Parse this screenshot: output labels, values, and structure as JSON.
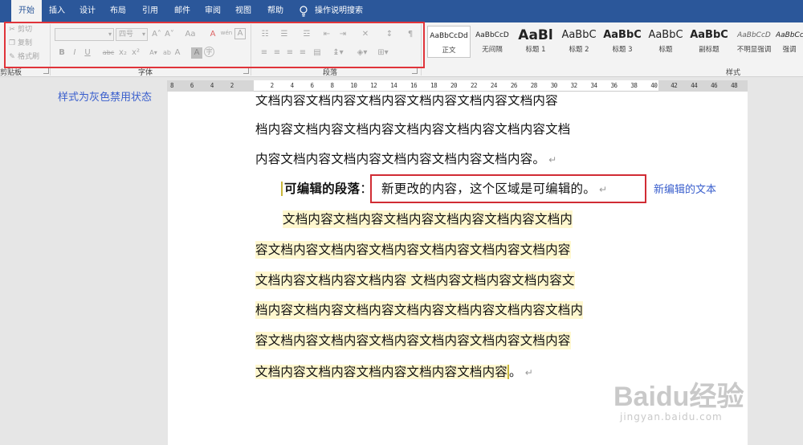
{
  "tabs": [
    {
      "label": "开始",
      "active": true
    },
    {
      "label": "插入"
    },
    {
      "label": "设计"
    },
    {
      "label": "布局"
    },
    {
      "label": "引用"
    },
    {
      "label": "邮件"
    },
    {
      "label": "审阅"
    },
    {
      "label": "视图"
    },
    {
      "label": "帮助"
    }
  ],
  "tell_me": "操作说明搜索",
  "ribbon": {
    "clipboard": {
      "cut": "剪切",
      "copy": "复制",
      "format_painter": "格式刷",
      "label": "剪贴板"
    },
    "font": {
      "font_name": "",
      "font_size": "四号",
      "bold": "B",
      "italic": "I",
      "underline": "U",
      "strikethrough": "abc",
      "subscript": "x₂",
      "superscript": "x²",
      "label": "字体",
      "grow": "A˄",
      "shrink": "A˅",
      "case": "Aa",
      "clear": "A",
      "phonetic": "wén",
      "border_char": "A",
      "highlight": "ab",
      "font_color": "A",
      "shading": "A",
      "enclose": "字"
    },
    "paragraph": {
      "label": "段落"
    },
    "styles": {
      "label": "样式",
      "items": [
        {
          "sample": "AaBbCcDd",
          "name": "正文",
          "selected": true
        },
        {
          "sample": "AaBbCcD",
          "name": "无间隔"
        },
        {
          "sample": "AaBl",
          "name": "标题 1"
        },
        {
          "sample": "AaBbC",
          "name": "标题 2"
        },
        {
          "sample": "AaBbC",
          "name": "标题 3"
        },
        {
          "sample": "AaBbC",
          "name": "标题"
        },
        {
          "sample": "AaBbC",
          "name": "副标题"
        },
        {
          "sample": "AaBbCcD",
          "name": "不明显强调"
        },
        {
          "sample": "AaBbCc",
          "name": "强调"
        }
      ]
    }
  },
  "ruler": {
    "ticks": [
      "8",
      "6",
      "4",
      "2",
      "",
      "2",
      "4",
      "6",
      "8",
      "10",
      "12",
      "14",
      "16",
      "18",
      "20",
      "22",
      "24",
      "26",
      "28",
      "30",
      "32",
      "34",
      "36",
      "38",
      "40",
      "42",
      "44",
      "46",
      "48"
    ]
  },
  "annotations": {
    "disabled_note": "样式为灰色禁用状态",
    "edited_note": "新编辑的文本"
  },
  "document": {
    "top_lines": [
      "文档内容文档内容文档内容文档内容文档内容文档内容",
      "档内容文档内容文档内容文档内容文档内容文档内容文档",
      "内容文档内容文档内容文档内容文档内容文档内容。"
    ],
    "editable_label": "可编辑的段落",
    "editable_colon": "：",
    "editable_text": "新更改的内容，这个区域是可编辑的。",
    "yellow_lines": [
      "文档内容文档内容文档内容文档内容文档内容文档内",
      "容文档内容文档内容文档内容文档内容文档内容文档内容",
      "文档内容文档内容文档内容 文档内容文档内容文档内容文",
      "档内容文档内容文档内容文档内容文档内容文档内容文档内",
      "容文档内容文档内容文档内容文档内容文档内容文档内容",
      "文档内容文档内容文档内容文档内容文档内容"
    ],
    "final_period": "。"
  },
  "watermark": {
    "brand": "Baidu经验",
    "url": "jingyan.baidu.com"
  },
  "colors": {
    "tab_bar": "#2b579a",
    "highlight_box": "#e0343a",
    "annotation": "#3a5fcd",
    "editable_region": "#fff7cf"
  }
}
